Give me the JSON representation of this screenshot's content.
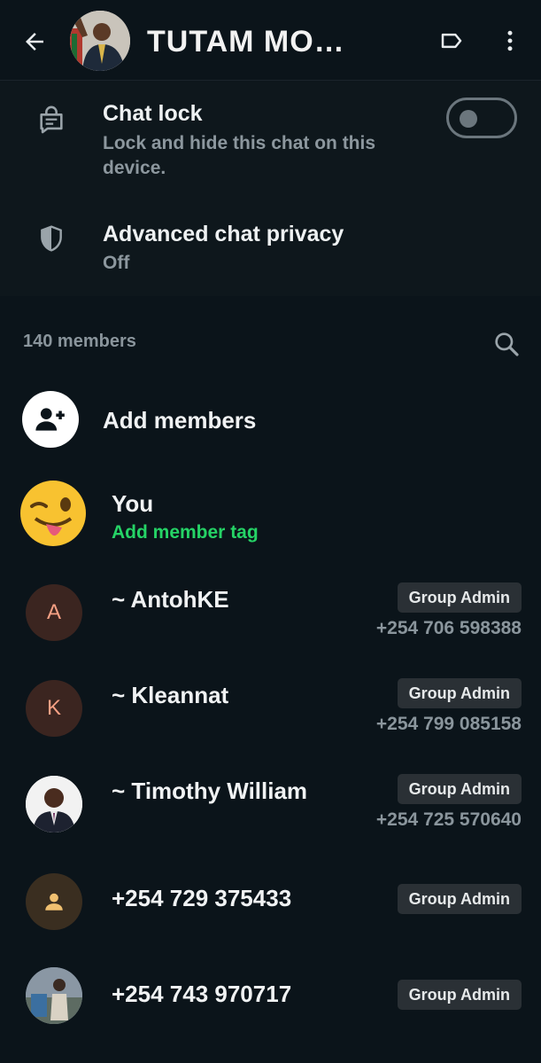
{
  "header": {
    "title": "TUTAM MO…"
  },
  "settings": {
    "chat_lock": {
      "title": "Chat lock",
      "subtitle": "Lock and hide this chat on this device.",
      "enabled": false
    },
    "privacy": {
      "title": "Advanced chat privacy",
      "subtitle": "Off"
    }
  },
  "members": {
    "count_label": "140 members",
    "add_label": "Add members",
    "you": {
      "name": "You",
      "tag_link": "Add member tag"
    },
    "list": [
      {
        "name": "~ AntohKE",
        "phone": "+254 706 598388",
        "badge": "Group Admin",
        "initial": "A"
      },
      {
        "name": "~ Kleannat",
        "phone": "+254 799 085158",
        "badge": "Group Admin",
        "initial": "K"
      },
      {
        "name": "~ Timothy William",
        "phone": "+254 725 570640",
        "badge": "Group Admin"
      },
      {
        "name": "+254 729 375433",
        "badge": "Group Admin"
      },
      {
        "name": "+254 743 970717",
        "badge": "Group Admin"
      }
    ]
  },
  "colors": {
    "background": "#0b141a",
    "accent_green": "#25d366",
    "muted_text": "#8a959c",
    "badge_bg": "#2a3035"
  }
}
